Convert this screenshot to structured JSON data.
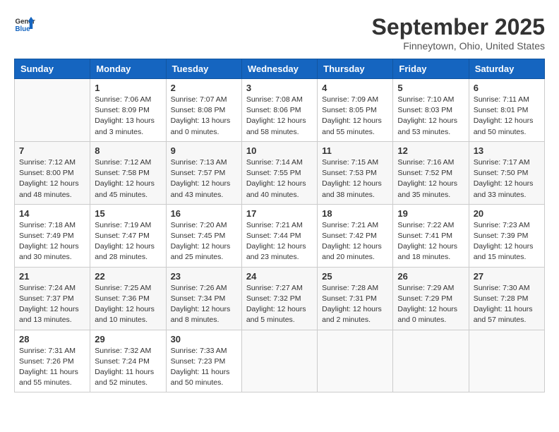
{
  "header": {
    "logo_general": "General",
    "logo_blue": "Blue",
    "month": "September 2025",
    "location": "Finneytown, Ohio, United States"
  },
  "days_of_week": [
    "Sunday",
    "Monday",
    "Tuesday",
    "Wednesday",
    "Thursday",
    "Friday",
    "Saturday"
  ],
  "weeks": [
    [
      {
        "day": "",
        "info": ""
      },
      {
        "day": "1",
        "info": "Sunrise: 7:06 AM\nSunset: 8:09 PM\nDaylight: 13 hours\nand 3 minutes."
      },
      {
        "day": "2",
        "info": "Sunrise: 7:07 AM\nSunset: 8:08 PM\nDaylight: 13 hours\nand 0 minutes."
      },
      {
        "day": "3",
        "info": "Sunrise: 7:08 AM\nSunset: 8:06 PM\nDaylight: 12 hours\nand 58 minutes."
      },
      {
        "day": "4",
        "info": "Sunrise: 7:09 AM\nSunset: 8:05 PM\nDaylight: 12 hours\nand 55 minutes."
      },
      {
        "day": "5",
        "info": "Sunrise: 7:10 AM\nSunset: 8:03 PM\nDaylight: 12 hours\nand 53 minutes."
      },
      {
        "day": "6",
        "info": "Sunrise: 7:11 AM\nSunset: 8:01 PM\nDaylight: 12 hours\nand 50 minutes."
      }
    ],
    [
      {
        "day": "7",
        "info": "Sunrise: 7:12 AM\nSunset: 8:00 PM\nDaylight: 12 hours\nand 48 minutes."
      },
      {
        "day": "8",
        "info": "Sunrise: 7:12 AM\nSunset: 7:58 PM\nDaylight: 12 hours\nand 45 minutes."
      },
      {
        "day": "9",
        "info": "Sunrise: 7:13 AM\nSunset: 7:57 PM\nDaylight: 12 hours\nand 43 minutes."
      },
      {
        "day": "10",
        "info": "Sunrise: 7:14 AM\nSunset: 7:55 PM\nDaylight: 12 hours\nand 40 minutes."
      },
      {
        "day": "11",
        "info": "Sunrise: 7:15 AM\nSunset: 7:53 PM\nDaylight: 12 hours\nand 38 minutes."
      },
      {
        "day": "12",
        "info": "Sunrise: 7:16 AM\nSunset: 7:52 PM\nDaylight: 12 hours\nand 35 minutes."
      },
      {
        "day": "13",
        "info": "Sunrise: 7:17 AM\nSunset: 7:50 PM\nDaylight: 12 hours\nand 33 minutes."
      }
    ],
    [
      {
        "day": "14",
        "info": "Sunrise: 7:18 AM\nSunset: 7:49 PM\nDaylight: 12 hours\nand 30 minutes."
      },
      {
        "day": "15",
        "info": "Sunrise: 7:19 AM\nSunset: 7:47 PM\nDaylight: 12 hours\nand 28 minutes."
      },
      {
        "day": "16",
        "info": "Sunrise: 7:20 AM\nSunset: 7:45 PM\nDaylight: 12 hours\nand 25 minutes."
      },
      {
        "day": "17",
        "info": "Sunrise: 7:21 AM\nSunset: 7:44 PM\nDaylight: 12 hours\nand 23 minutes."
      },
      {
        "day": "18",
        "info": "Sunrise: 7:21 AM\nSunset: 7:42 PM\nDaylight: 12 hours\nand 20 minutes."
      },
      {
        "day": "19",
        "info": "Sunrise: 7:22 AM\nSunset: 7:41 PM\nDaylight: 12 hours\nand 18 minutes."
      },
      {
        "day": "20",
        "info": "Sunrise: 7:23 AM\nSunset: 7:39 PM\nDaylight: 12 hours\nand 15 minutes."
      }
    ],
    [
      {
        "day": "21",
        "info": "Sunrise: 7:24 AM\nSunset: 7:37 PM\nDaylight: 12 hours\nand 13 minutes."
      },
      {
        "day": "22",
        "info": "Sunrise: 7:25 AM\nSunset: 7:36 PM\nDaylight: 12 hours\nand 10 minutes."
      },
      {
        "day": "23",
        "info": "Sunrise: 7:26 AM\nSunset: 7:34 PM\nDaylight: 12 hours\nand 8 minutes."
      },
      {
        "day": "24",
        "info": "Sunrise: 7:27 AM\nSunset: 7:32 PM\nDaylight: 12 hours\nand 5 minutes."
      },
      {
        "day": "25",
        "info": "Sunrise: 7:28 AM\nSunset: 7:31 PM\nDaylight: 12 hours\nand 2 minutes."
      },
      {
        "day": "26",
        "info": "Sunrise: 7:29 AM\nSunset: 7:29 PM\nDaylight: 12 hours\nand 0 minutes."
      },
      {
        "day": "27",
        "info": "Sunrise: 7:30 AM\nSunset: 7:28 PM\nDaylight: 11 hours\nand 57 minutes."
      }
    ],
    [
      {
        "day": "28",
        "info": "Sunrise: 7:31 AM\nSunset: 7:26 PM\nDaylight: 11 hours\nand 55 minutes."
      },
      {
        "day": "29",
        "info": "Sunrise: 7:32 AM\nSunset: 7:24 PM\nDaylight: 11 hours\nand 52 minutes."
      },
      {
        "day": "30",
        "info": "Sunrise: 7:33 AM\nSunset: 7:23 PM\nDaylight: 11 hours\nand 50 minutes."
      },
      {
        "day": "",
        "info": ""
      },
      {
        "day": "",
        "info": ""
      },
      {
        "day": "",
        "info": ""
      },
      {
        "day": "",
        "info": ""
      }
    ]
  ]
}
